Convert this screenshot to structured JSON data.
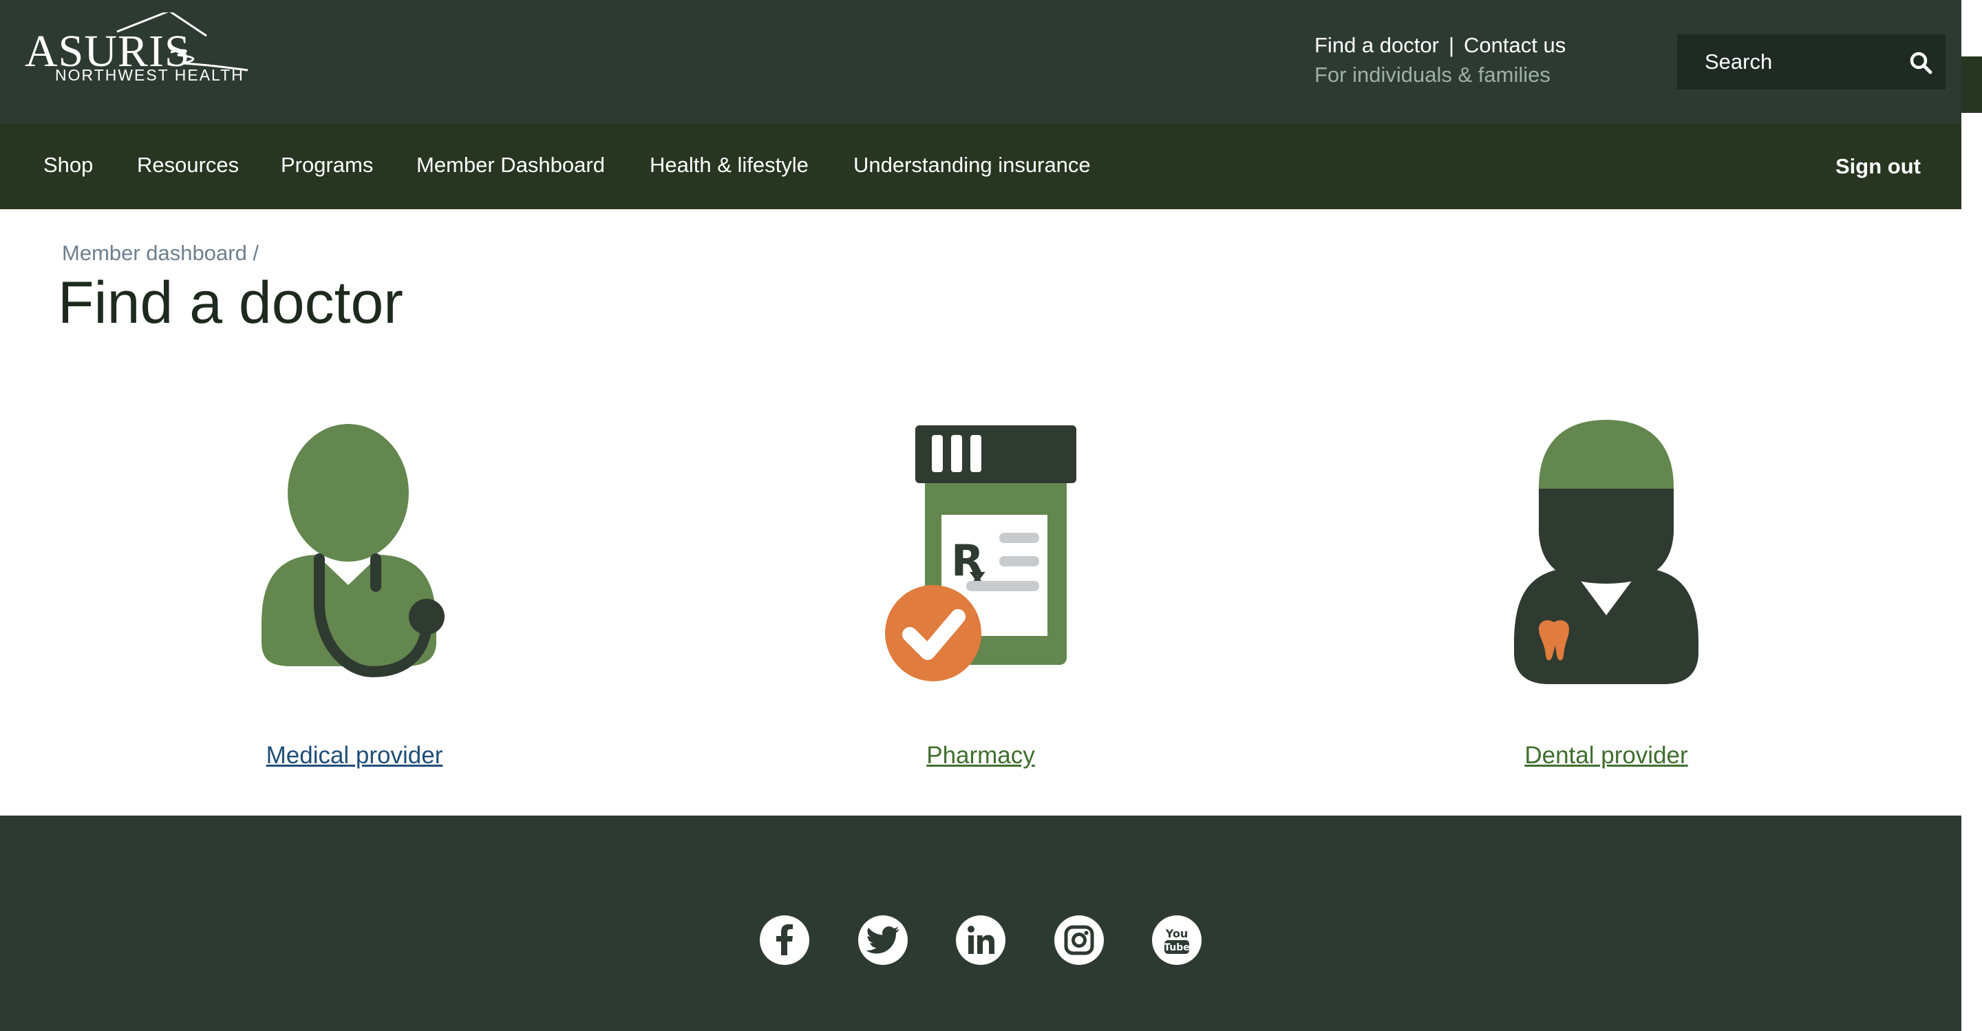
{
  "header": {
    "logo_word": "ASURIS",
    "logo_sub": "NORTHWEST HEALTH",
    "find_doctor": "Find a doctor",
    "separator": "|",
    "contact": "Contact us",
    "audience": "For individuals & families",
    "search_placeholder": "Search"
  },
  "nav": {
    "items": [
      "Shop",
      "Resources",
      "Programs",
      "Member Dashboard",
      "Health & lifestyle",
      "Understanding insurance"
    ],
    "sign_out": "Sign out"
  },
  "page": {
    "breadcrumb": "Member dashboard /",
    "title": "Find a doctor"
  },
  "cards": [
    {
      "label": "Medical provider",
      "icon": "doctor-stethoscope-icon",
      "link_color": "#1f4e79"
    },
    {
      "label": "Pharmacy",
      "icon": "pharmacy-rx-bottle-icon",
      "link_color": "#3f6e2e"
    },
    {
      "label": "Dental provider",
      "icon": "dentist-tooth-icon",
      "link_color": "#3f6e2e"
    }
  ],
  "footer": {
    "social": [
      "facebook-icon",
      "twitter-icon",
      "linkedin-icon",
      "instagram-icon",
      "youtube-icon"
    ],
    "youtube_text_1": "You",
    "youtube_text_2": "Tube"
  },
  "colors": {
    "header_bg": "#2d3a31",
    "nav_bg": "#283520",
    "icon_green": "#63874e",
    "icon_dark": "#2f3a31",
    "accent_orange": "#e07c3e"
  }
}
